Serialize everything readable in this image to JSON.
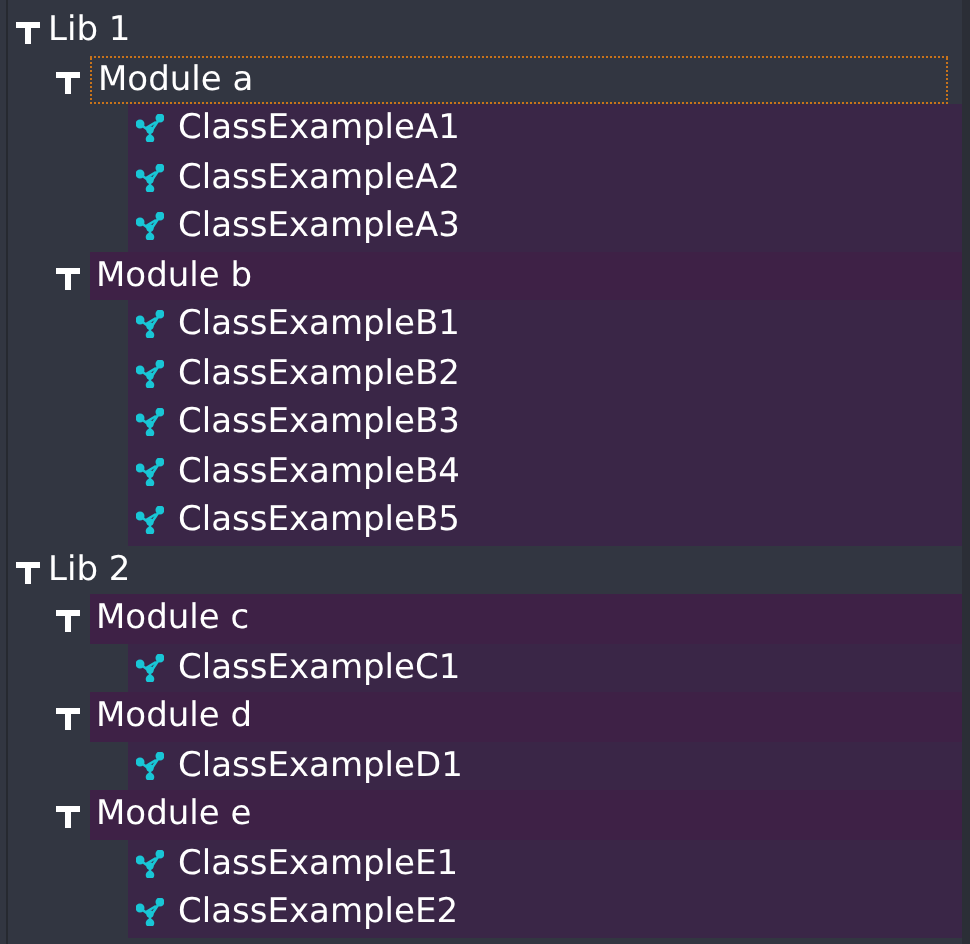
{
  "tree": [
    {
      "label": "Lib 1",
      "expanded": true,
      "children": [
        {
          "label": "Module a",
          "expanded": true,
          "focused": true,
          "children": [
            {
              "label": "ClassExampleA1"
            },
            {
              "label": "ClassExampleA2"
            },
            {
              "label": "ClassExampleA3"
            }
          ]
        },
        {
          "label": "Module b",
          "expanded": true,
          "focused": false,
          "children": [
            {
              "label": "ClassExampleB1"
            },
            {
              "label": "ClassExampleB2"
            },
            {
              "label": "ClassExampleB3"
            },
            {
              "label": "ClassExampleB4"
            },
            {
              "label": "ClassExampleB5"
            }
          ]
        }
      ]
    },
    {
      "label": "Lib 2",
      "expanded": true,
      "children": [
        {
          "label": "Module c",
          "expanded": true,
          "focused": false,
          "children": [
            {
              "label": "ClassExampleC1"
            }
          ]
        },
        {
          "label": "Module d",
          "expanded": true,
          "focused": false,
          "children": [
            {
              "label": "ClassExampleD1"
            }
          ]
        },
        {
          "label": "Module e",
          "expanded": true,
          "focused": false,
          "children": [
            {
              "label": "ClassExampleE1"
            },
            {
              "label": "ClassExampleE2"
            }
          ]
        }
      ]
    }
  ]
}
